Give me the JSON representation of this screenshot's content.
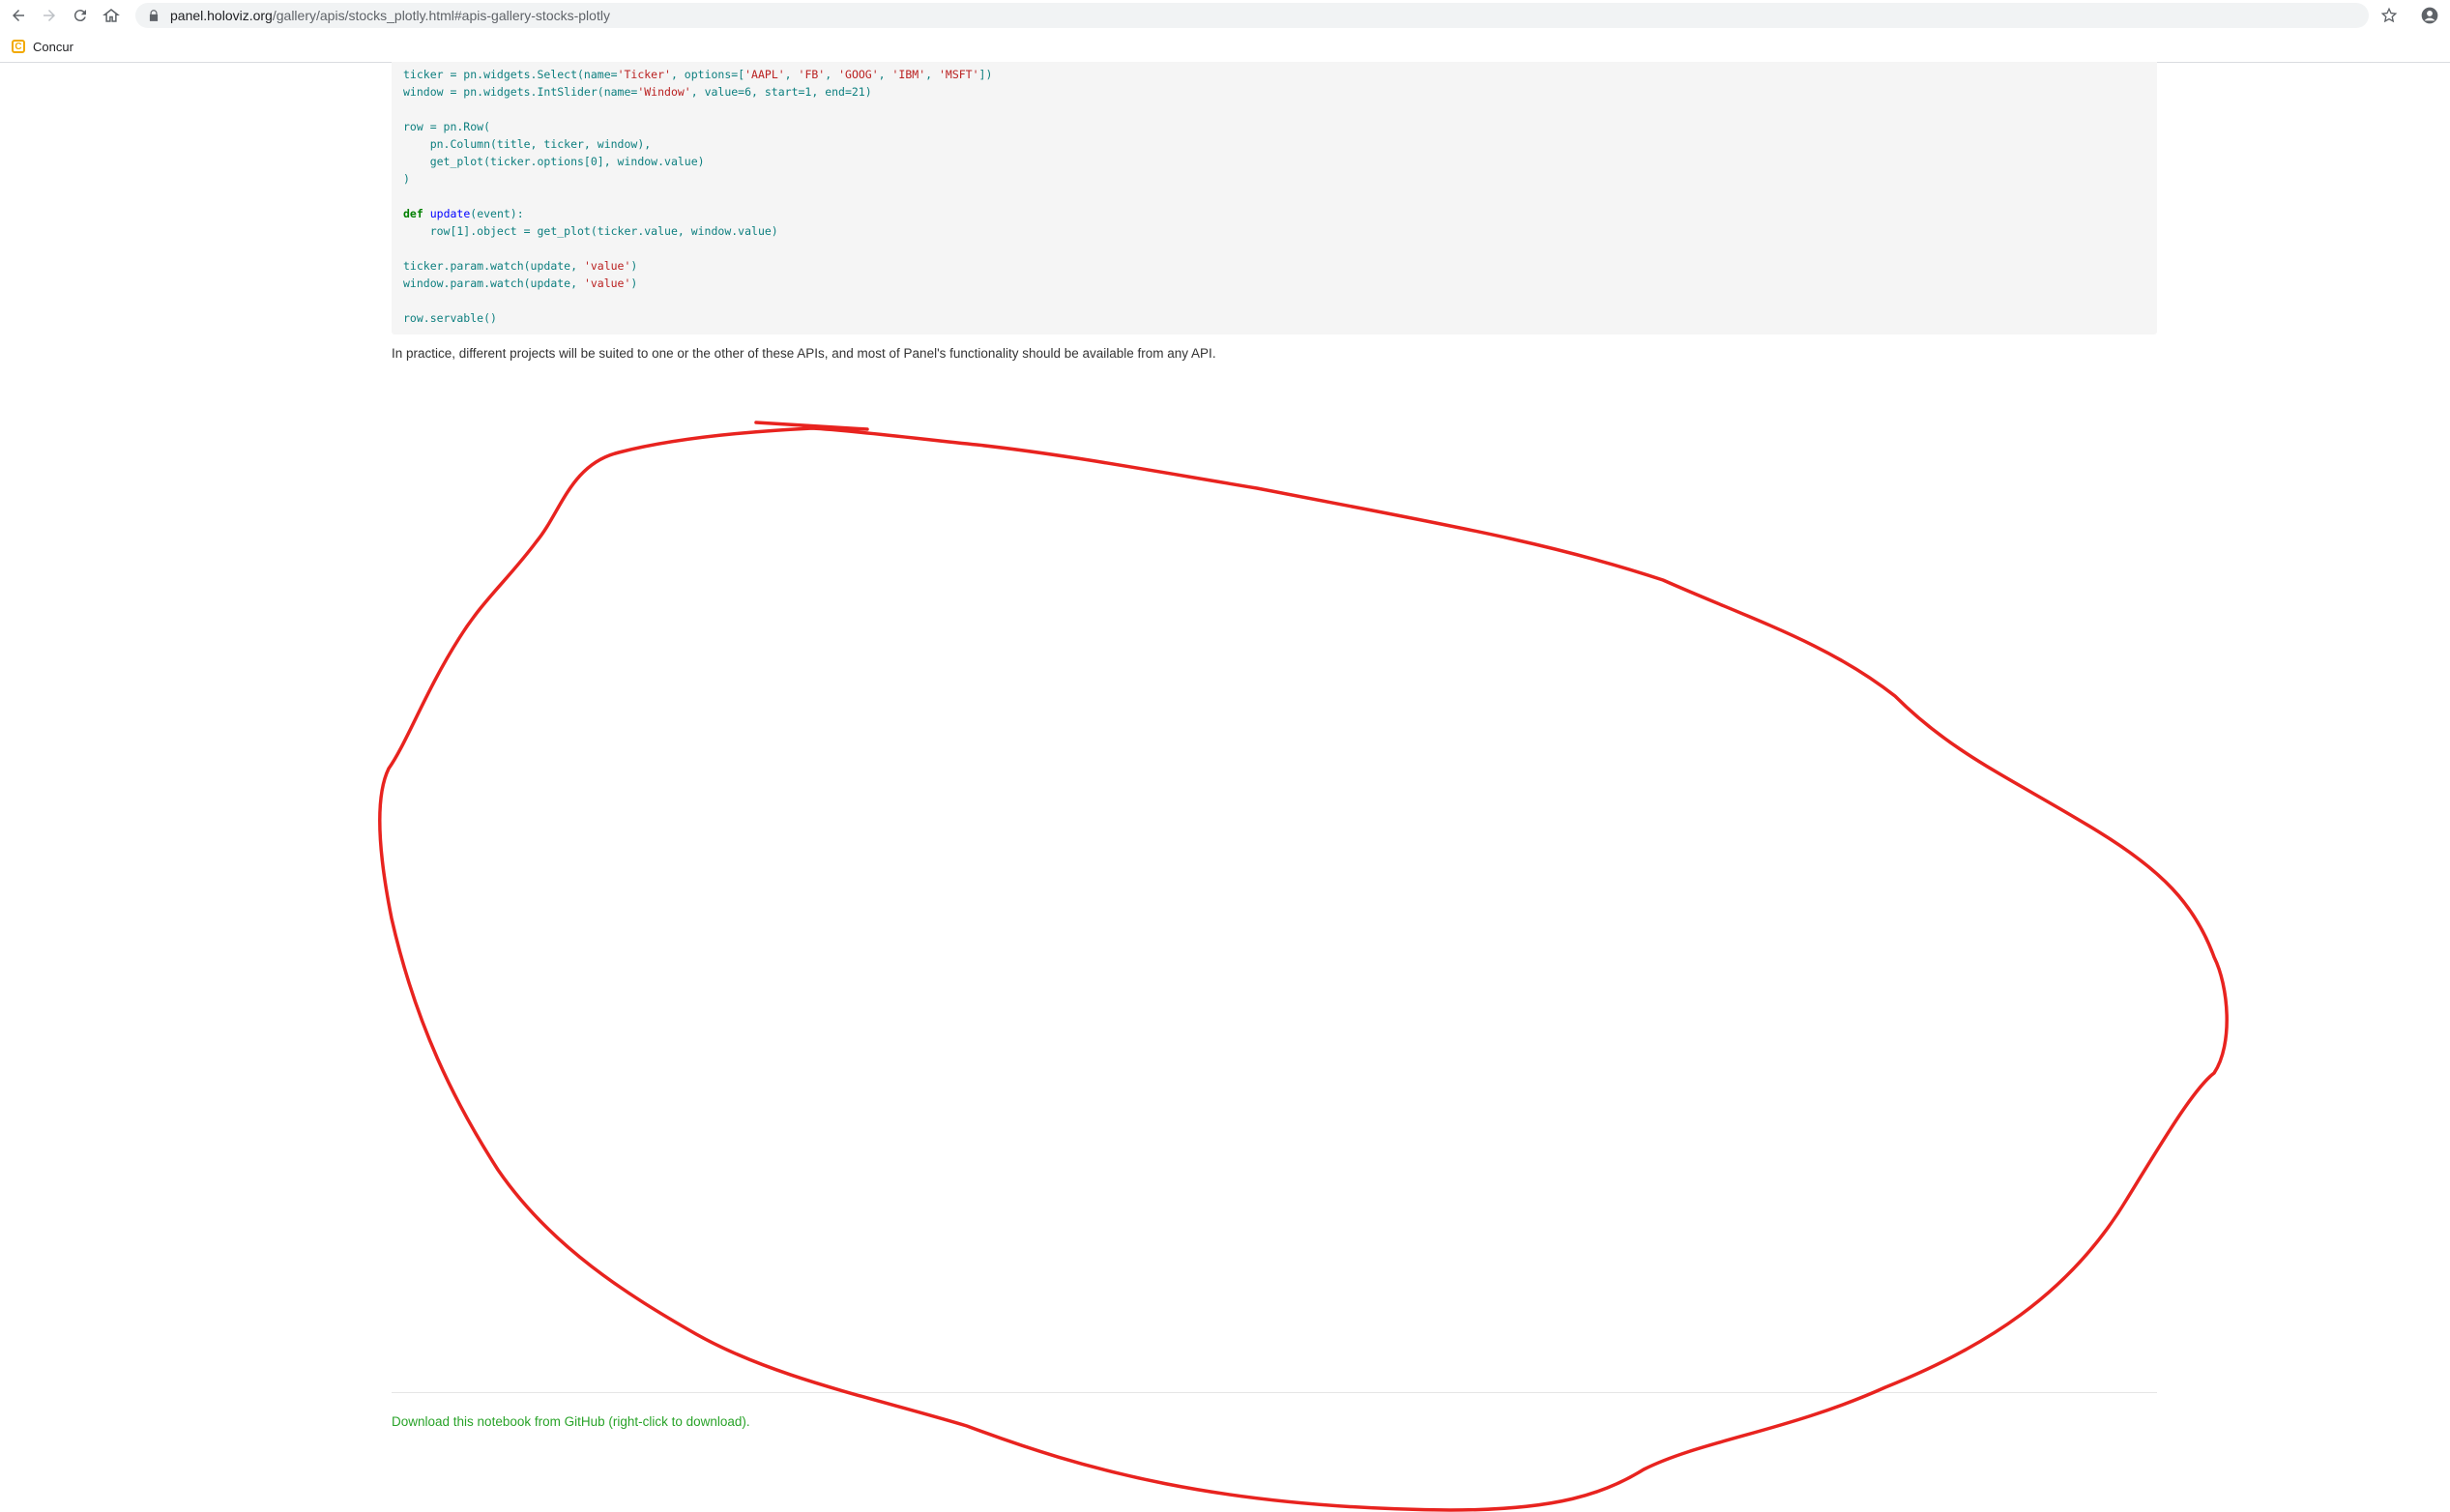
{
  "browser": {
    "url_host": "panel.holoviz.org",
    "url_path": "/gallery/apis/stocks_plotly.html#apis-gallery-stocks-plotly",
    "bookmarks": [
      {
        "icon": "concur-icon",
        "label": "Concur"
      }
    ]
  },
  "code": {
    "lines": [
      "ticker = pn.widgets.Select(name='Ticker', options=['AAPL', 'FB', 'GOOG', 'IBM', 'MSFT'])",
      "window = pn.widgets.IntSlider(name='Window', value=6, start=1, end=21)",
      "",
      "row = pn.Row(",
      "    pn.Column(title, ticker, window),",
      "    get_plot(ticker.options[0], window.value)",
      ")",
      "",
      "def update(event):",
      "    row[1].object = get_plot(ticker.value, window.value)",
      "",
      "ticker.param.watch(update, 'value')",
      "window.param.watch(update, 'value')",
      "",
      "row.servable()"
    ]
  },
  "content": {
    "paragraph": "In practice, different projects will be suited to one or the other of these APIs, and most of Panel's functionality should be available from any API.",
    "download_link": "Download this notebook from GitHub (right-click to download)."
  },
  "colors": {
    "annotation_stroke": "#e8231f",
    "link": "#29a329"
  }
}
